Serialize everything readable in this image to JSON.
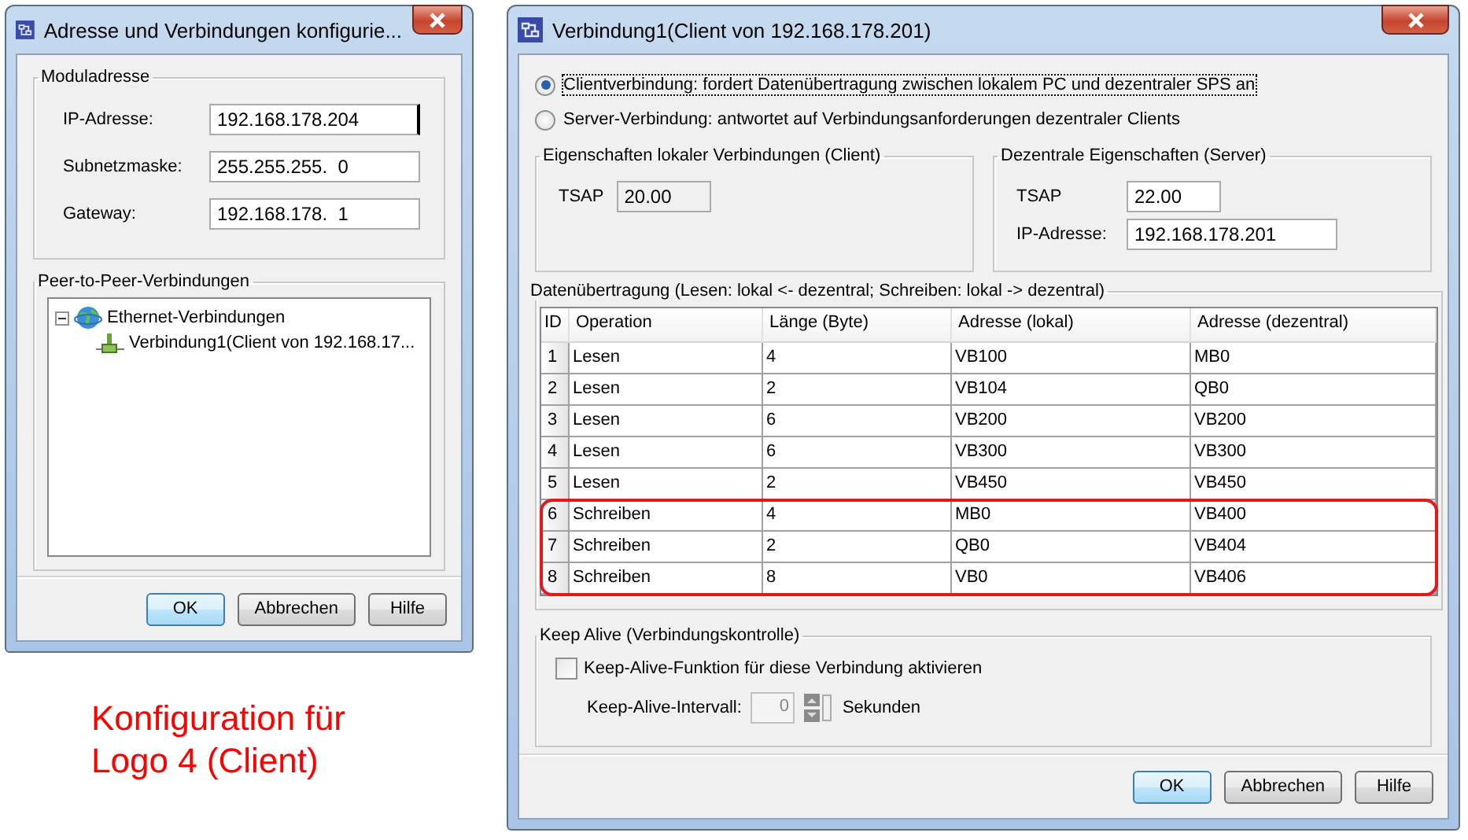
{
  "left_window": {
    "title": "Adresse und Verbindungen konfigurie...",
    "module_group": {
      "title": "Moduladresse",
      "fields": [
        {
          "label": "IP-Adresse:",
          "value": "192.168.178.204",
          "focused": true
        },
        {
          "label": "Subnetzmaske:",
          "value": "255.255.255.  0",
          "focused": false
        },
        {
          "label": "Gateway:",
          "value": "192.168.178.  1",
          "focused": false
        }
      ]
    },
    "peer_group": {
      "title": "Peer-to-Peer-Verbindungen",
      "tree": [
        {
          "label": "Ethernet-Verbindungen",
          "kind": "network",
          "expanded": true,
          "children": [
            {
              "label": "Verbindung1(Client von  192.168.17...",
              "kind": "connection"
            }
          ]
        }
      ]
    },
    "buttons": [
      {
        "label": "OK",
        "default": true
      },
      {
        "label": "Abbrechen",
        "default": false
      },
      {
        "label": "Hilfe",
        "default": false
      }
    ]
  },
  "caption": [
    "Konfiguration für",
    "Logo 4 (Client)"
  ],
  "right_window": {
    "title": "Verbindung1(Client von  192.168.178.201)",
    "modes": [
      {
        "label": "Clientverbindung: fordert Datenübertragung zwischen lokalem PC und dezentraler SPS an",
        "selected": true
      },
      {
        "label": "Server-Verbindung: antwortet auf Verbindungsanforderungen dezentraler Clients",
        "selected": false
      }
    ],
    "local_group": {
      "title": "Eigenschaften lokaler Verbindungen (Client)",
      "fields": [
        {
          "label": "TSAP",
          "value": "20.00",
          "disabled": true
        }
      ]
    },
    "remote_group": {
      "title": "Dezentrale Eigenschaften (Server)",
      "fields": [
        {
          "label": "TSAP",
          "value": "22.00",
          "disabled": false
        },
        {
          "label": "IP-Adresse:",
          "value": "192.168.178.201",
          "disabled": false
        }
      ]
    },
    "transfer_group": {
      "title": "Datenübertragung (Lesen: lokal <- dezentral; Schreiben: lokal -> dezentral)",
      "columns": [
        "ID",
        "Operation",
        "Länge (Byte)",
        "Adresse (lokal)",
        "Adresse (dezentral)"
      ],
      "rows": [
        {
          "cells": [
            "1",
            "Lesen",
            "4",
            "VB100",
            "MB0"
          ],
          "highlighted": false
        },
        {
          "cells": [
            "2",
            "Lesen",
            "2",
            "VB104",
            "QB0"
          ],
          "highlighted": false
        },
        {
          "cells": [
            "3",
            "Lesen",
            "6",
            "VB200",
            "VB200"
          ],
          "highlighted": false
        },
        {
          "cells": [
            "4",
            "Lesen",
            "6",
            "VB300",
            "VB300"
          ],
          "highlighted": false
        },
        {
          "cells": [
            "5",
            "Lesen",
            "2",
            "VB450",
            "VB450"
          ],
          "highlighted": false
        },
        {
          "cells": [
            "6",
            "Schreiben",
            "4",
            "MB0",
            "VB400"
          ],
          "highlighted": true
        },
        {
          "cells": [
            "7",
            "Schreiben",
            "2",
            "QB0",
            "VB404"
          ],
          "highlighted": true
        },
        {
          "cells": [
            "8",
            "Schreiben",
            "8",
            "VB0",
            "VB406"
          ],
          "highlighted": true
        }
      ]
    },
    "keepalive_group": {
      "title": "Keep Alive (Verbindungskontrolle)",
      "checkbox": {
        "label": "Keep-Alive-Funktion für diese Verbindung aktivieren",
        "checked": false
      },
      "interval": {
        "label": "Keep-Alive-Intervall:",
        "value": "0",
        "unit": "Sekunden",
        "disabled": true
      }
    },
    "buttons": [
      {
        "label": "OK",
        "default": true
      },
      {
        "label": "Abbrechen",
        "default": false
      },
      {
        "label": "Hilfe",
        "default": false
      }
    ]
  }
}
